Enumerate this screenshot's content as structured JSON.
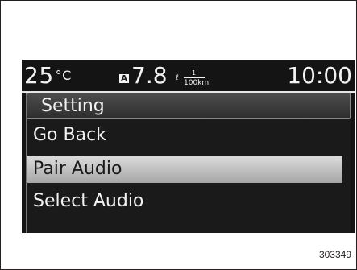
{
  "status_bar": {
    "temperature": "25",
    "temperature_unit": "°C",
    "fuel_mode_badge": "A",
    "fuel_economy": "7.8",
    "fuel_unit_numerator": "1",
    "fuel_unit_liter": "ℓ",
    "fuel_unit_denominator": "100km",
    "clock": "10:00"
  },
  "menu": {
    "title": "Setting",
    "items": [
      {
        "label": "Go Back"
      },
      {
        "label": "Pair Audio"
      },
      {
        "label": "Select Audio"
      }
    ],
    "selected_item": "Pair Audio"
  },
  "figure_id": "303349",
  "colors": {
    "screen_background": "#141414",
    "text": "#f2f2f2",
    "highlight": "#c8c8c8"
  }
}
